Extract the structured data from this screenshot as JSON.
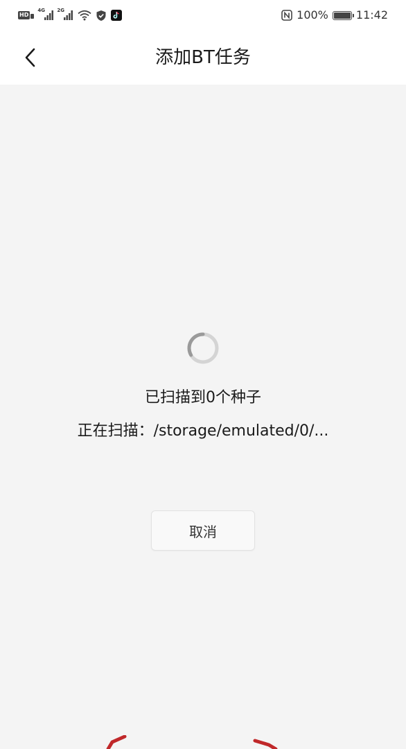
{
  "status_bar": {
    "hd_label": "HD",
    "net_4g": "4G",
    "net_2g": "2G",
    "battery_text": "100%",
    "battery_level": 1.0,
    "time": "11:42"
  },
  "header": {
    "title": "添加BT任务"
  },
  "scan": {
    "count_text": "已扫描到0个种子",
    "path_text": "正在扫描：/storage/emulated/0/..."
  },
  "actions": {
    "cancel_label": "取消"
  },
  "colors": {
    "background": "#f4f4f4",
    "bar": "#ffffff",
    "text": "#1a1a1a",
    "button_bg": "#f9f9f9",
    "accent_mark": "#c0282a"
  },
  "icons": {
    "back": "chevron-left-icon",
    "spinner": "loading-spinner-icon",
    "wifi": "wifi-icon",
    "shield": "shield-check-icon",
    "nfc": "nfc-icon",
    "battery": "battery-icon"
  }
}
